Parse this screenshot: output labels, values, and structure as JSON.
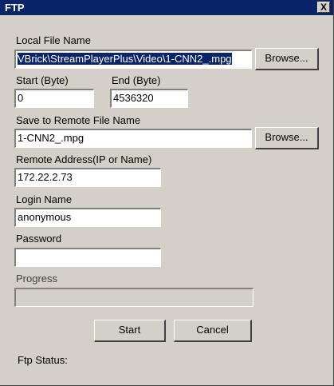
{
  "window": {
    "title": "FTP",
    "close_glyph": "X"
  },
  "local_file": {
    "label": "Local File Name",
    "value": "VBrick\\StreamPlayerPlus\\Video\\1-CNN2_.mpg",
    "browse_label": "Browse..."
  },
  "start_byte": {
    "label": "Start (Byte)",
    "value": "0"
  },
  "end_byte": {
    "label": "End (Byte)",
    "value": "4536320"
  },
  "remote_file": {
    "label": "Save to Remote File Name",
    "value": "1-CNN2_.mpg",
    "browse_label": "Browse..."
  },
  "remote_address": {
    "label": "Remote Address(IP or Name)",
    "value": "172.22.2.73"
  },
  "login": {
    "label": "Login Name",
    "value": "anonymous"
  },
  "password": {
    "label": "Password",
    "value": ""
  },
  "progress": {
    "label": "Progress",
    "value": 0
  },
  "buttons": {
    "start": "Start",
    "cancel": "Cancel"
  },
  "status": {
    "label": "Ftp Status:"
  }
}
